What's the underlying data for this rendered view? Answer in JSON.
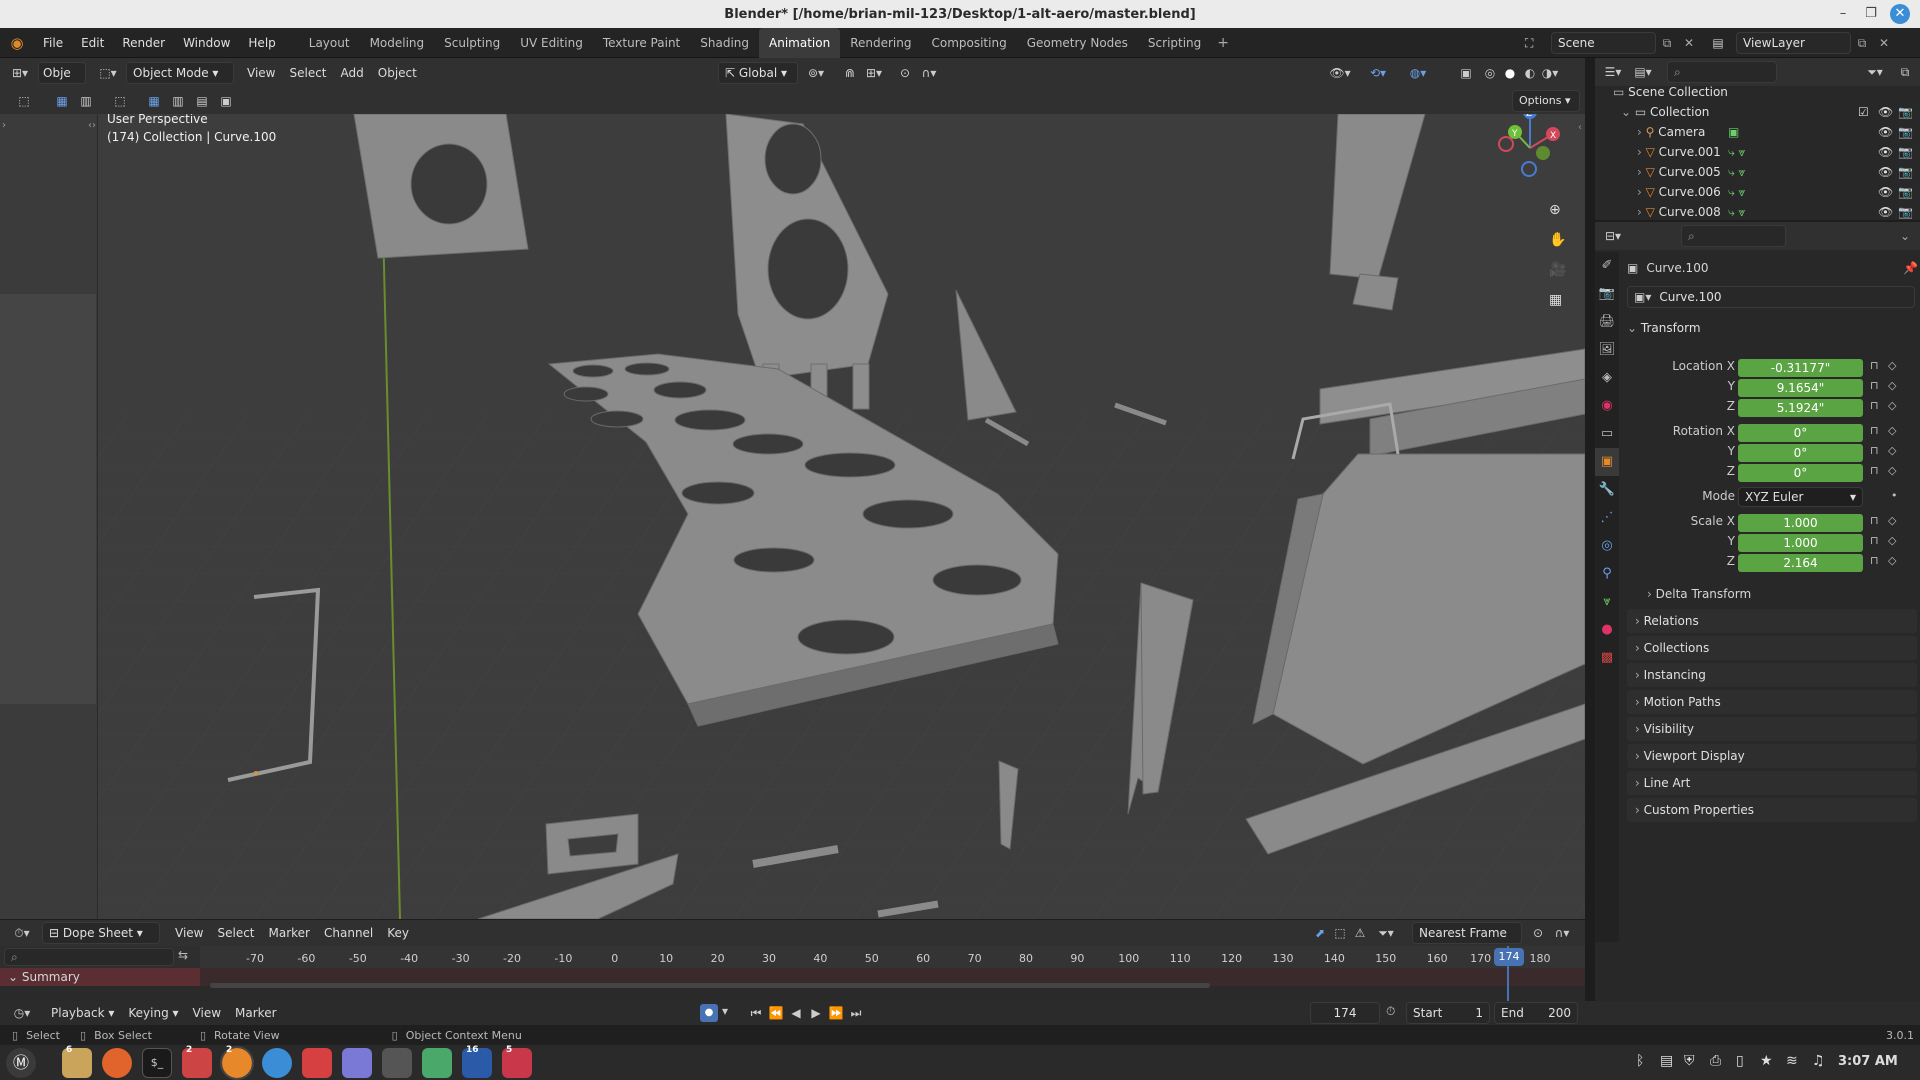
{
  "window": {
    "title": "Blender* [/home/brian-mil-123/Desktop/1-alt-aero/master.blend]"
  },
  "menu": [
    "File",
    "Edit",
    "Render",
    "Window",
    "Help"
  ],
  "workspaces": [
    "Layout",
    "Modeling",
    "Sculpting",
    "UV Editing",
    "Texture Paint",
    "Shading",
    "Animation",
    "Rendering",
    "Compositing",
    "Geometry Nodes",
    "Scripting"
  ],
  "active_workspace": "Animation",
  "scene": {
    "name": "Scene",
    "view_layer": "ViewLayer"
  },
  "viewport_header": {
    "editor_short": "Obje",
    "mode": "Object Mode",
    "menus": [
      "View",
      "Select",
      "Add",
      "Object"
    ],
    "orientation": "Global",
    "options": "Options"
  },
  "viewport": {
    "perspective": "User Perspective",
    "collection_info": "(174) Collection | Curve.100",
    "gizmo_axes": [
      "X",
      "Y",
      "Z"
    ]
  },
  "outliner": {
    "scene_collection": "Scene Collection",
    "collection": "Collection",
    "items": [
      {
        "name": "Camera",
        "icon": "camera-icon"
      },
      {
        "name": "Curve.001",
        "icon": "curve-icon"
      },
      {
        "name": "Curve.005",
        "icon": "curve-icon"
      },
      {
        "name": "Curve.006",
        "icon": "curve-icon"
      },
      {
        "name": "Curve.008",
        "icon": "curve-icon"
      }
    ]
  },
  "properties": {
    "object_name": "Curve.100",
    "data_name": "Curve.100",
    "transform_label": "Transform",
    "location": {
      "label": "Location X",
      "x": "-0.31177\"",
      "y": "9.1654\"",
      "z": "5.1924\""
    },
    "rotation": {
      "label": "Rotation X",
      "x": "0°",
      "y": "0°",
      "z": "0°"
    },
    "axis_y": "Y",
    "axis_z": "Z",
    "mode_label": "Mode",
    "mode_value": "XYZ Euler",
    "scale": {
      "label": "Scale X",
      "x": "1.000",
      "y": "1.000",
      "z": "2.164"
    },
    "delta_transform": "Delta Transform",
    "sections": [
      "Relations",
      "Collections",
      "Instancing",
      "Motion Paths",
      "Visibility",
      "Viewport Display",
      "Line Art",
      "Custom Properties"
    ]
  },
  "dopesheet": {
    "editor": "Dope Sheet",
    "menus": [
      "View",
      "Select",
      "Marker",
      "Channel",
      "Key"
    ],
    "snap": "Nearest Frame",
    "summary": "Summary",
    "ticks": [
      "-70",
      "-60",
      "-50",
      "-40",
      "-30",
      "-20",
      "-10",
      "0",
      "10",
      "20",
      "30",
      "40",
      "50",
      "60",
      "70",
      "80",
      "90",
      "100",
      "110",
      "120",
      "130",
      "140",
      "150",
      "160",
      "170",
      "180"
    ],
    "current_frame": "174"
  },
  "playback": {
    "menus": [
      "Playback",
      "Keying",
      "View",
      "Marker"
    ],
    "frame": "174",
    "start_label": "Start",
    "start": "1",
    "end_label": "End",
    "end": "200"
  },
  "status": {
    "select": "Select",
    "box_select": "Box Select",
    "rotate_view": "Rotate View",
    "context_menu": "Object Context Menu",
    "version": "3.0.1"
  },
  "taskbar": {
    "time": "3:07 AM",
    "badges": [
      "6",
      "2",
      "2",
      "16",
      "5"
    ]
  },
  "colors": {
    "accent": "#4772b3",
    "field_green": "#5aa444",
    "active_frame": "#4772b3"
  }
}
